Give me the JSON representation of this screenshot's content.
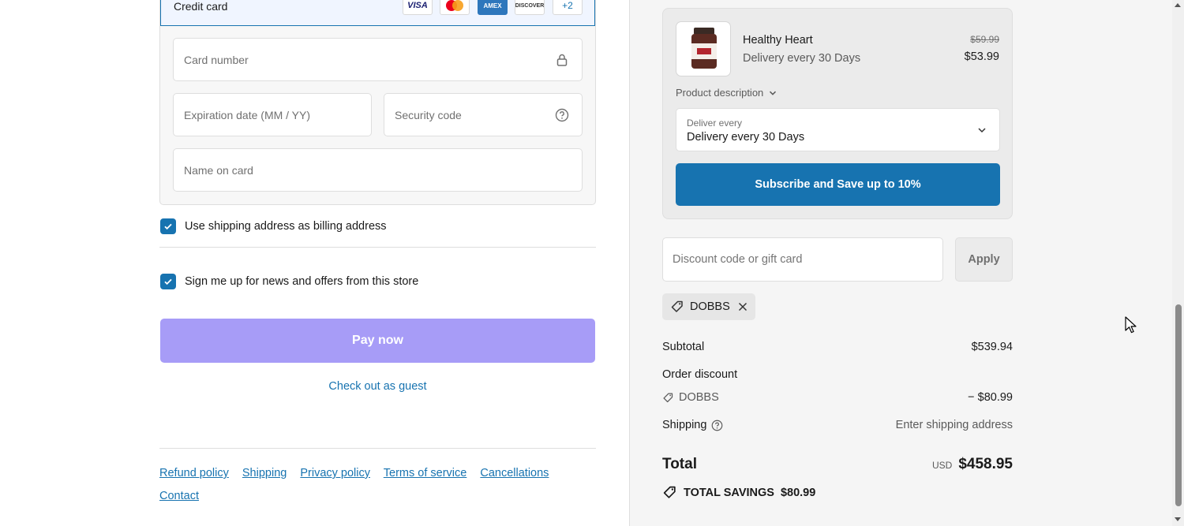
{
  "payment": {
    "method_label": "Credit card",
    "card_brands": [
      "VISA",
      "Mastercard",
      "AMEX",
      "DISCOVER"
    ],
    "more_brands": "+2",
    "card_number_placeholder": "Card number",
    "expiration_placeholder": "Expiration date (MM / YY)",
    "security_code_placeholder": "Security code",
    "name_on_card_placeholder": "Name on card"
  },
  "options": {
    "use_shipping_as_billing": "Use shipping address as billing address",
    "newsletter": "Sign me up for news and offers from this store"
  },
  "actions": {
    "pay_now": "Pay now",
    "guest": "Check out as guest"
  },
  "footer": {
    "links": [
      "Refund policy",
      "Shipping",
      "Privacy policy",
      "Terms of service",
      "Cancellations",
      "Contact"
    ]
  },
  "product": {
    "name": "Healthy Heart",
    "variant": "Delivery every 30 Days",
    "price_original": "$59.99",
    "price_current": "$53.99",
    "description_toggle": "Product description",
    "deliver_label": "Deliver every",
    "deliver_value": "Delivery every 30 Days",
    "subscribe_button": "Subscribe and Save up to 10%"
  },
  "discount": {
    "placeholder": "Discount code or gift card",
    "apply_label": "Apply",
    "applied_code": "DOBBS"
  },
  "summary": {
    "subtotal_label": "Subtotal",
    "subtotal_value": "$539.94",
    "order_discount_label": "Order discount",
    "discount_code": "DOBBS",
    "discount_value": "− $80.99",
    "shipping_label": "Shipping",
    "shipping_value": "Enter shipping address",
    "total_label": "Total",
    "total_currency": "USD",
    "total_value": "$458.95",
    "savings_label": "TOTAL SAVINGS",
    "savings_value": "$80.99"
  },
  "colors": {
    "accent": "#1773b0",
    "pay_button": "#a79cf7"
  }
}
